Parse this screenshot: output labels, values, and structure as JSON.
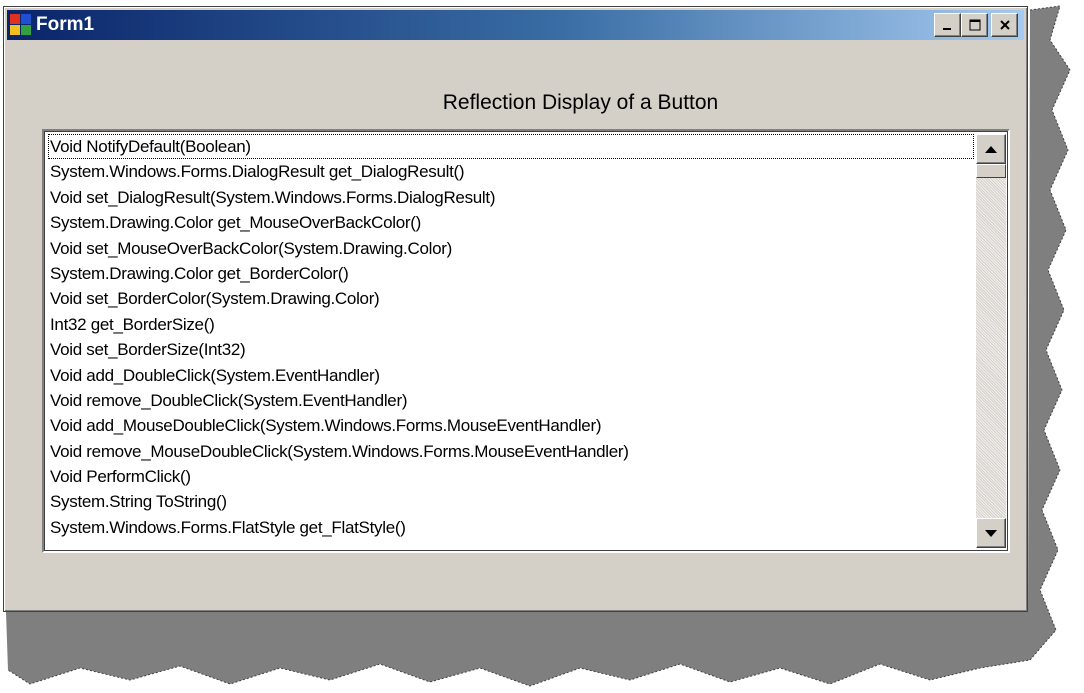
{
  "window": {
    "title": "Form1"
  },
  "form": {
    "heading": "Reflection Display of a Button"
  },
  "listbox": {
    "items": [
      "Void NotifyDefault(Boolean)",
      "System.Windows.Forms.DialogResult get_DialogResult()",
      "Void set_DialogResult(System.Windows.Forms.DialogResult)",
      "System.Drawing.Color get_MouseOverBackColor()",
      "Void set_MouseOverBackColor(System.Drawing.Color)",
      "System.Drawing.Color get_BorderColor()",
      "Void set_BorderColor(System.Drawing.Color)",
      "Int32 get_BorderSize()",
      "Void set_BorderSize(Int32)",
      "Void add_DoubleClick(System.EventHandler)",
      "Void remove_DoubleClick(System.EventHandler)",
      "Void add_MouseDoubleClick(System.Windows.Forms.MouseEventHandler)",
      "Void remove_MouseDoubleClick(System.Windows.Forms.MouseEventHandler)",
      "Void PerformClick()",
      "System.String ToString()",
      "System.Windows.Forms.FlatStyle get_FlatStyle()"
    ],
    "focused_index": 0
  },
  "icons": {
    "app": "form-app-icon",
    "minimize": "minimize-icon",
    "maximize": "maximize-icon",
    "close": "close-icon",
    "scroll_up": "scroll-up-arrow-icon",
    "scroll_down": "scroll-down-arrow-icon"
  },
  "colors": {
    "window_face": "#d4d0c8",
    "titlebar_start": "#0a246a",
    "titlebar_end": "#a6caf0",
    "list_background": "#ffffff"
  }
}
